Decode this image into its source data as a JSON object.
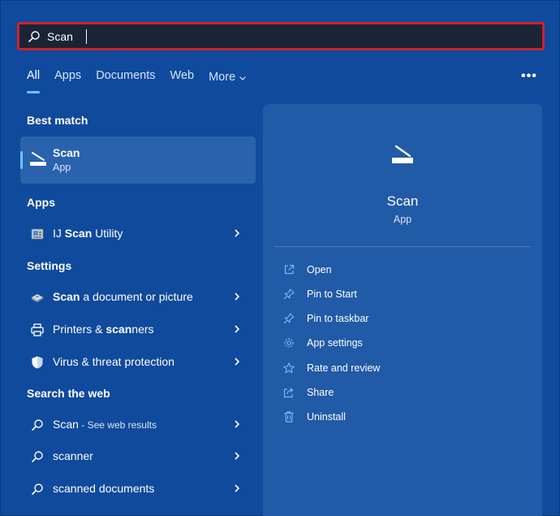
{
  "search": {
    "value": "Scan",
    "placeholder": ""
  },
  "tabs": [
    {
      "label": "All",
      "active": true
    },
    {
      "label": "Apps"
    },
    {
      "label": "Documents"
    },
    {
      "label": "Web"
    },
    {
      "label": "More"
    }
  ],
  "sections": {
    "best_match": "Best match",
    "apps": "Apps",
    "settings": "Settings",
    "search_web": "Search the web"
  },
  "best_match": {
    "title": "Scan",
    "subtitle": "App",
    "icon": "scanner-icon"
  },
  "apps": [
    {
      "bold": "Scan",
      "pre": "IJ ",
      "post": " Utility",
      "icon": "ij-scan-utility-icon"
    }
  ],
  "settings": [
    {
      "bold": "Scan",
      "post": " a document or picture",
      "icon": "scan-device-icon"
    },
    {
      "pre": "Printers & ",
      "bold": "scan",
      "post": "ners",
      "icon": "printer-icon"
    },
    {
      "post": "Virus & threat protection",
      "icon": "shield-icon"
    }
  ],
  "web": [
    {
      "text": "Scan",
      "small": " - See web results",
      "icon": "search-icon"
    },
    {
      "text": "scanner",
      "icon": "search-icon"
    },
    {
      "text": "scanned documents",
      "icon": "search-icon"
    }
  ],
  "panel": {
    "title": "Scan",
    "subtitle": "App",
    "icon": "scanner-icon",
    "actions": [
      {
        "label": "Open",
        "icon": "open-external-icon"
      },
      {
        "label": "Pin to Start",
        "icon": "pin-icon"
      },
      {
        "label": "Pin to taskbar",
        "icon": "pin-icon"
      },
      {
        "label": "App settings",
        "icon": "gear-icon"
      },
      {
        "label": "Rate and review",
        "icon": "star-icon"
      },
      {
        "label": "Share",
        "icon": "share-icon"
      },
      {
        "label": "Uninstall",
        "icon": "trash-icon"
      }
    ]
  },
  "colors": {
    "background": "#0f4a9c",
    "panel": "#215aa7",
    "highlight": "#2a62ae",
    "accent": "#6cc3ff",
    "search_border": "#d0202a"
  }
}
